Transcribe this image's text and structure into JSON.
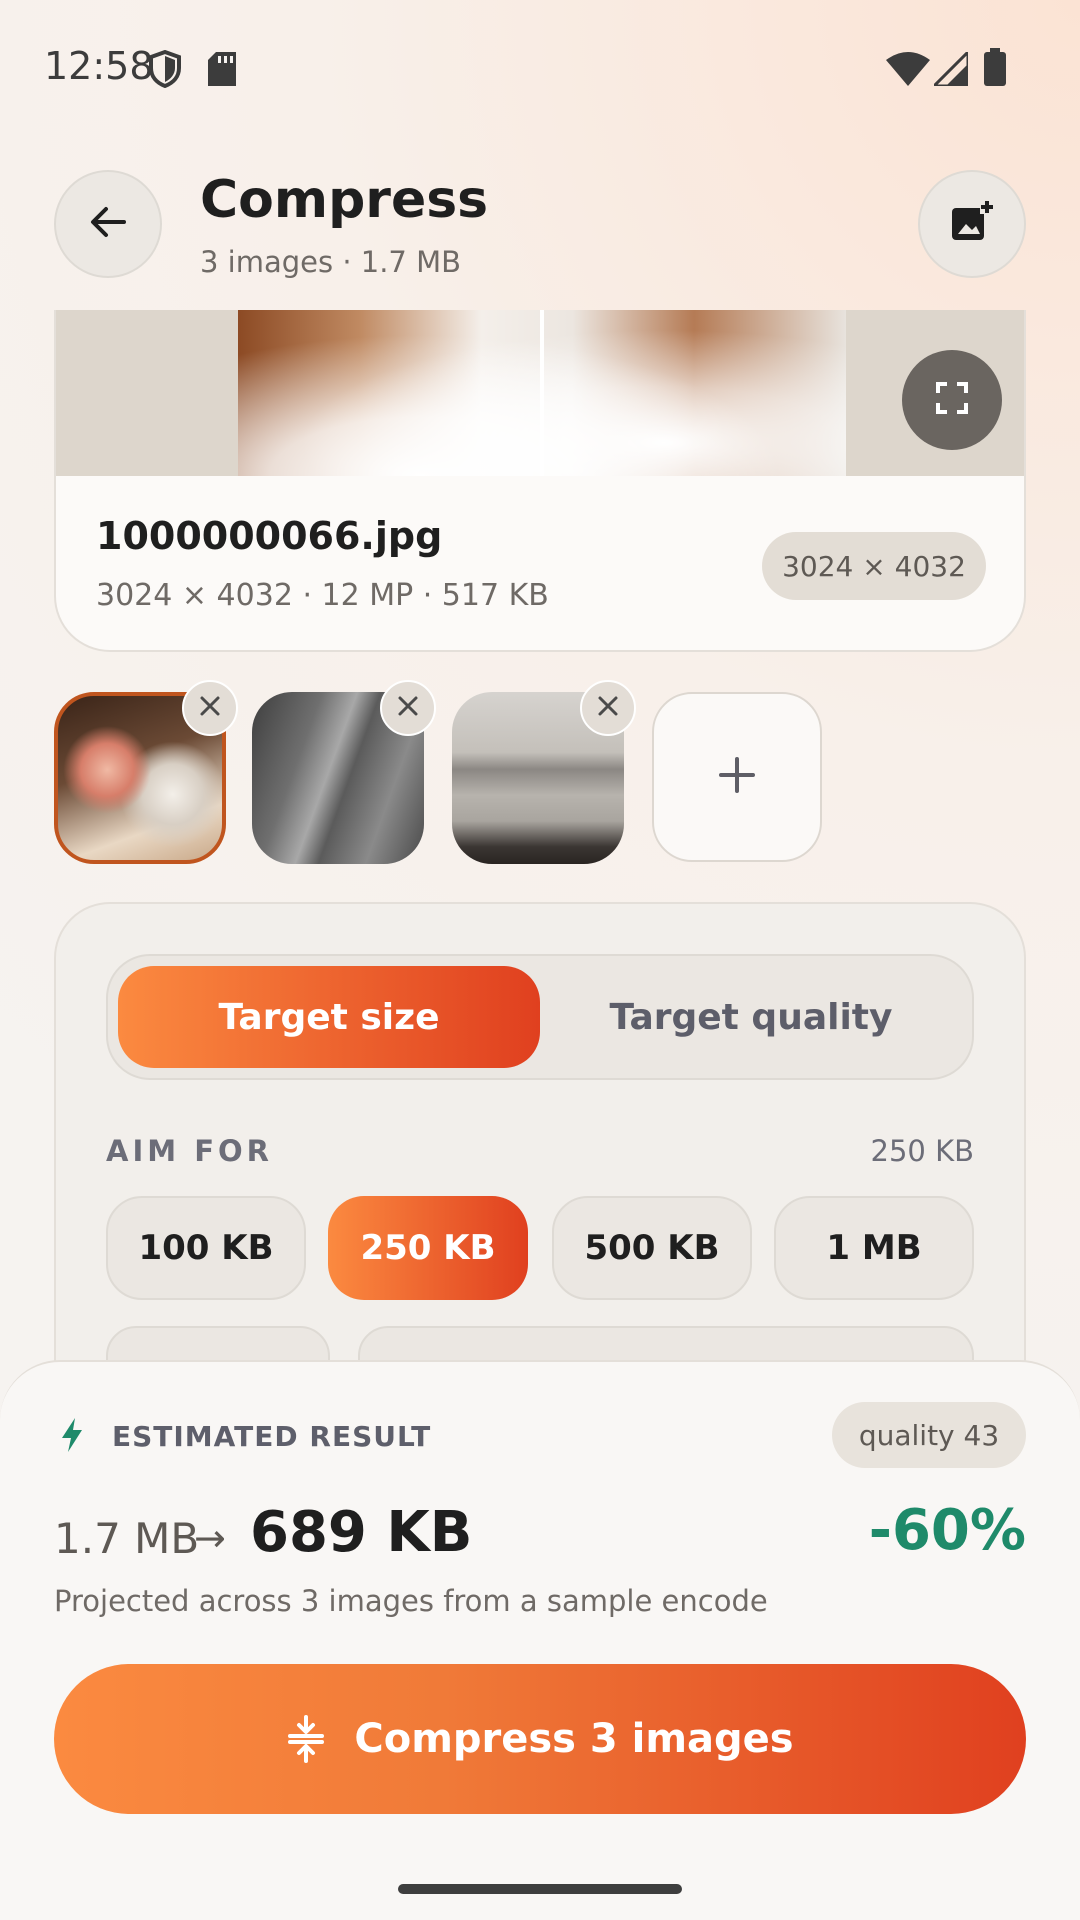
{
  "status_bar": {
    "time": "12:58"
  },
  "header": {
    "title": "Compress",
    "subtitle": "3 images · 1.7 MB"
  },
  "preview": {
    "filename": "1000000066.jpg",
    "info": "3024 × 4032 · 12 MP · 517 KB",
    "dimensions_badge": "3024 × 4032"
  },
  "thumbnails": [
    {
      "name": "thumbnail-teacup",
      "selected": true
    },
    {
      "name": "thumbnail-bridge",
      "selected": false
    },
    {
      "name": "thumbnail-skyline",
      "selected": false
    }
  ],
  "mode": {
    "tabs": [
      "Target size",
      "Target quality"
    ],
    "selected": 0
  },
  "aim": {
    "label": "AIM FOR",
    "value": "250 KB",
    "chips": [
      "100 KB",
      "250 KB",
      "500 KB",
      "1 MB"
    ],
    "selected": 1
  },
  "estimate": {
    "label": "ESTIMATED RESULT",
    "quality": "quality 43",
    "from": "1.7 MB",
    "arrow": "→",
    "to": "689 KB",
    "percent": "-60%",
    "note": "Projected across 3 images from a sample encode"
  },
  "cta": {
    "label": "Compress 3 images"
  },
  "colors": {
    "accent_start": "#fb8a40",
    "accent_end": "#e0401f",
    "success": "#1f8a6a"
  },
  "icons": [
    "shield-icon",
    "sd-card-icon",
    "wifi-icon",
    "signal-icon",
    "battery-icon",
    "back-arrow-icon",
    "add-photo-icon",
    "fullscreen-icon",
    "close-icon",
    "plus-icon",
    "bolt-icon",
    "compress-icon"
  ]
}
